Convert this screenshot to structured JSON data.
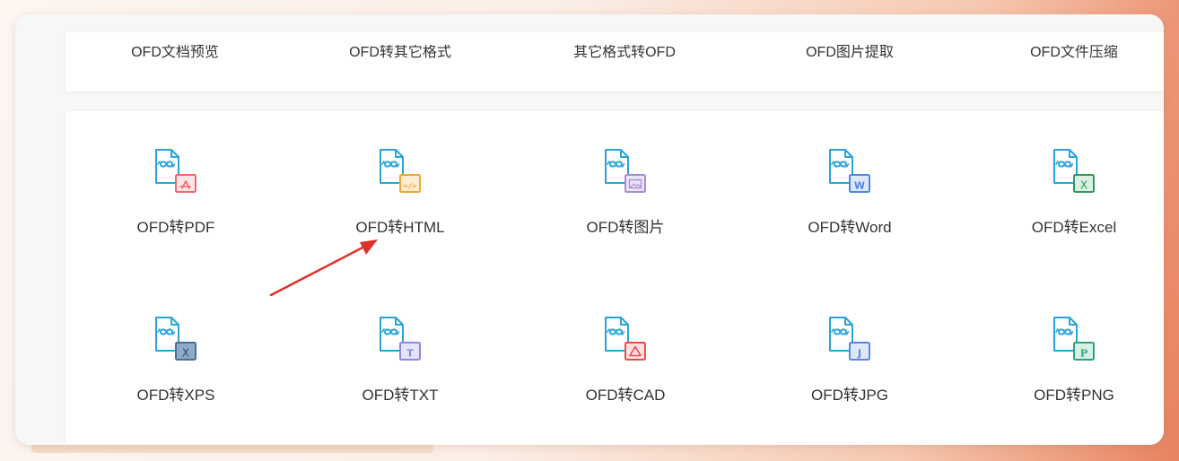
{
  "top_nav": {
    "items": [
      {
        "label": "OFD文档预览"
      },
      {
        "label": "OFD转其它格式"
      },
      {
        "label": "其它格式转OFD"
      },
      {
        "label": "OFD图片提取"
      },
      {
        "label": "OFD文件压缩"
      }
    ]
  },
  "tools": [
    {
      "label": "OFD转PDF",
      "icon": "pdf-icon",
      "badge_color": "#f0686e",
      "badge_bg": "#fde4e5",
      "glyph": "pdf"
    },
    {
      "label": "OFD转HTML",
      "icon": "html-icon",
      "badge_color": "#f5a33b",
      "badge_bg": "#fdebd2",
      "glyph": "</>"
    },
    {
      "label": "OFD转图片",
      "icon": "image-icon",
      "badge_color": "#a78bd6",
      "badge_bg": "#ece4f8",
      "glyph": "img"
    },
    {
      "label": "OFD转Word",
      "icon": "word-icon",
      "badge_color": "#4f86e6",
      "badge_bg": "#dde8fb",
      "glyph": "W"
    },
    {
      "label": "OFD转Excel",
      "icon": "excel-icon",
      "badge_color": "#2f9a5a",
      "badge_bg": "#d9f0e2",
      "glyph": "X"
    },
    {
      "label": "OFD转XPS",
      "icon": "xps-icon",
      "badge_color": "#4d6f93",
      "badge_bg": "#8eaac8",
      "glyph": "X"
    },
    {
      "label": "OFD转TXT",
      "icon": "txt-icon",
      "badge_color": "#8d87e0",
      "badge_bg": "#e5e3fa",
      "glyph": "T"
    },
    {
      "label": "OFD转CAD",
      "icon": "cad-icon",
      "badge_color": "#ee4a4a",
      "badge_bg": "#fde1e1",
      "glyph": "cad"
    },
    {
      "label": "OFD转JPG",
      "icon": "jpg-icon",
      "badge_color": "#5a86e8",
      "badge_bg": "#dfe8fb",
      "glyph": "J"
    },
    {
      "label": "OFD转PNG",
      "icon": "png-icon",
      "badge_color": "#2fa37a",
      "badge_bg": "#d8f1e7",
      "glyph": "P"
    }
  ],
  "colors": {
    "doc_outline": "#29a4d9",
    "arrow": "#e1302a",
    "text": "#333333"
  }
}
